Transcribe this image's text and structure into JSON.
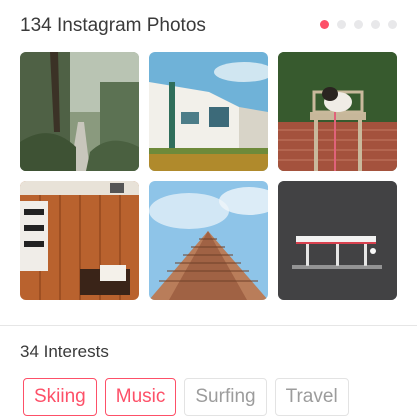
{
  "photos_section": {
    "title": "134 Instagram Photos",
    "page_dots": {
      "count": 5,
      "active_index": 0
    },
    "photos": [
      {
        "name": "forest-path"
      },
      {
        "name": "modern-house"
      },
      {
        "name": "dog-on-chair"
      },
      {
        "name": "wooden-desk"
      },
      {
        "name": "skyscraper"
      },
      {
        "name": "gas-station-night"
      }
    ]
  },
  "interests_section": {
    "title": "34 Interests",
    "chips": [
      {
        "label": "Skiing",
        "selected": true
      },
      {
        "label": "Music",
        "selected": true
      },
      {
        "label": "Surfing",
        "selected": false
      },
      {
        "label": "Travel",
        "selected": false
      }
    ]
  },
  "colors": {
    "accent": "#fd5068",
    "dot_inactive": "#e8e8ea",
    "chip_border": "#e3e3e3"
  }
}
